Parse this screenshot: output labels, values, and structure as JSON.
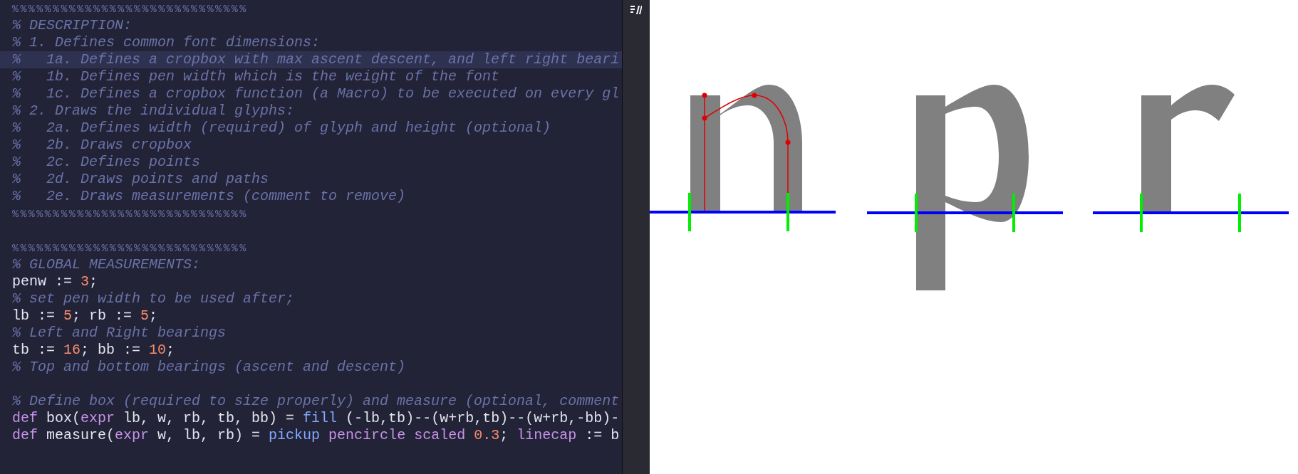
{
  "editor": {
    "lines": [
      {
        "kind": "code",
        "current": false,
        "tokens": [
          {
            "text": "%%%%%%%%%%%%%%%%%%%%%%%%%%%%%",
            "kind": "rule"
          }
        ]
      },
      {
        "kind": "code",
        "current": false,
        "tokens": [
          {
            "text": "% DESCRIPTION:",
            "kind": "comment"
          }
        ]
      },
      {
        "kind": "code",
        "current": false,
        "tokens": [
          {
            "text": "% 1. Defines common font dimensions:",
            "kind": "comment"
          }
        ]
      },
      {
        "kind": "code",
        "current": true,
        "tokens": [
          {
            "text": "%   1a. Defines a cropbox with max ascent descent, and left right beari",
            "kind": "comment"
          }
        ]
      },
      {
        "kind": "code",
        "current": false,
        "tokens": [
          {
            "text": "%   1b. Defines pen width which is the weight of the font",
            "kind": "comment"
          }
        ]
      },
      {
        "kind": "code",
        "current": false,
        "tokens": [
          {
            "text": "%   1c. Defines a cropbox function (a Macro) to be executed on every gl",
            "kind": "comment"
          }
        ]
      },
      {
        "kind": "code",
        "current": false,
        "tokens": [
          {
            "text": "% 2. Draws the individual glyphs:",
            "kind": "comment"
          }
        ]
      },
      {
        "kind": "code",
        "current": false,
        "tokens": [
          {
            "text": "%   2a. Defines width (required) of glyph and height (optional)",
            "kind": "comment"
          }
        ]
      },
      {
        "kind": "code",
        "current": false,
        "tokens": [
          {
            "text": "%   2b. Draws cropbox",
            "kind": "comment"
          }
        ]
      },
      {
        "kind": "code",
        "current": false,
        "tokens": [
          {
            "text": "%   2c. Defines points",
            "kind": "comment"
          }
        ]
      },
      {
        "kind": "code",
        "current": false,
        "tokens": [
          {
            "text": "%   2d. Draws points and paths",
            "kind": "comment"
          }
        ]
      },
      {
        "kind": "code",
        "current": false,
        "tokens": [
          {
            "text": "%   2e. Draws measurements (comment to remove)",
            "kind": "comment"
          }
        ]
      },
      {
        "kind": "code",
        "current": false,
        "tokens": [
          {
            "text": "%%%%%%%%%%%%%%%%%%%%%%%%%%%%%",
            "kind": "rule"
          }
        ]
      },
      {
        "kind": "blank",
        "current": false
      },
      {
        "kind": "code",
        "current": false,
        "tokens": [
          {
            "text": "%%%%%%%%%%%%%%%%%%%%%%%%%%%%%",
            "kind": "rule"
          }
        ]
      },
      {
        "kind": "code",
        "current": false,
        "tokens": [
          {
            "text": "% GLOBAL MEASUREMENTS:",
            "kind": "comment"
          }
        ]
      },
      {
        "kind": "code",
        "current": false,
        "tokens": [
          {
            "text": "penw := ",
            "kind": "plain"
          },
          {
            "text": "3",
            "kind": "number"
          },
          {
            "text": ";",
            "kind": "plain"
          }
        ]
      },
      {
        "kind": "code",
        "current": false,
        "tokens": [
          {
            "text": "% set pen width to be used after;",
            "kind": "comment"
          }
        ]
      },
      {
        "kind": "code",
        "current": false,
        "tokens": [
          {
            "text": "lb := ",
            "kind": "plain"
          },
          {
            "text": "5",
            "kind": "number"
          },
          {
            "text": "; rb := ",
            "kind": "plain"
          },
          {
            "text": "5",
            "kind": "number"
          },
          {
            "text": ";",
            "kind": "plain"
          }
        ]
      },
      {
        "kind": "code",
        "current": false,
        "tokens": [
          {
            "text": "% Left and Right bearings",
            "kind": "comment"
          }
        ]
      },
      {
        "kind": "code",
        "current": false,
        "tokens": [
          {
            "text": "tb := ",
            "kind": "plain"
          },
          {
            "text": "16",
            "kind": "number"
          },
          {
            "text": "; bb := ",
            "kind": "plain"
          },
          {
            "text": "10",
            "kind": "number"
          },
          {
            "text": ";",
            "kind": "plain"
          }
        ]
      },
      {
        "kind": "code",
        "current": false,
        "tokens": [
          {
            "text": "% Top and bottom bearings (ascent and descent)",
            "kind": "comment"
          }
        ]
      },
      {
        "kind": "blank",
        "current": false
      },
      {
        "kind": "code",
        "current": false,
        "tokens": [
          {
            "text": "% Define box (required to size properly) and measure (optional, comment",
            "kind": "comment"
          }
        ]
      },
      {
        "kind": "code",
        "current": false,
        "tokens": [
          {
            "text": "def",
            "kind": "keyword"
          },
          {
            "text": " box(",
            "kind": "plain"
          },
          {
            "text": "expr",
            "kind": "keyword"
          },
          {
            "text": " lb, w, rb, tb, bb) = ",
            "kind": "plain"
          },
          {
            "text": "fill",
            "kind": "builtin"
          },
          {
            "text": " (-lb,tb)--(w+rb,tb)--(w+rb,-bb)-",
            "kind": "plain"
          }
        ]
      },
      {
        "kind": "code",
        "current": false,
        "tokens": [
          {
            "text": "def",
            "kind": "keyword"
          },
          {
            "text": " measure(",
            "kind": "plain"
          },
          {
            "text": "expr",
            "kind": "keyword"
          },
          {
            "text": " w, lb, rb) = ",
            "kind": "plain"
          },
          {
            "text": "pickup",
            "kind": "builtin"
          },
          {
            "text": " pencircle scaled ",
            "kind": "keyword"
          },
          {
            "text": "0.3",
            "kind": "number"
          },
          {
            "text": "; ",
            "kind": "plain"
          },
          {
            "text": "linecap",
            "kind": "keyword"
          },
          {
            "text": " := b",
            "kind": "plain"
          }
        ]
      }
    ]
  }
}
